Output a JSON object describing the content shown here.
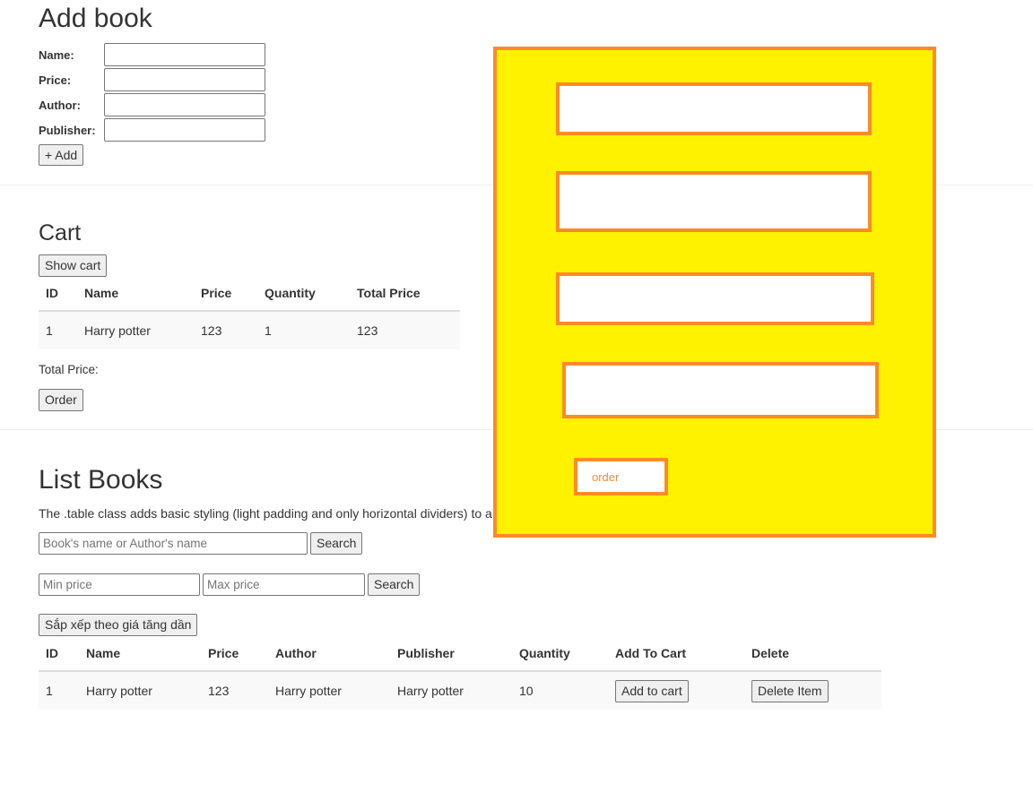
{
  "add_book": {
    "title": "Add book",
    "name_label": "Name:",
    "price_label": "Price:",
    "author_label": "Author:",
    "publisher_label": "Publisher:",
    "add_button": "+ Add"
  },
  "cart": {
    "title": "Cart",
    "show_button": "Show cart",
    "columns": [
      "ID",
      "Name",
      "Price",
      "Quantity",
      "Total Price"
    ],
    "rows": [
      [
        "1",
        "Harry potter",
        "123",
        "1",
        "123"
      ]
    ],
    "total_label": "Total Price:",
    "order_button": "Order"
  },
  "list_books": {
    "title": "List Books",
    "description": "The .table class adds basic styling (light padding and only horizontal dividers) to a",
    "search_placeholder": "Book's name or Author's name",
    "search_button": "Search",
    "min_placeholder": "Min price",
    "max_placeholder": "Max price",
    "price_search_button": "Search",
    "sort_button": "Sắp xếp theo giá tăng dần",
    "columns": [
      "ID",
      "Name",
      "Price",
      "Author",
      "Publisher",
      "Quantity",
      "Add To Cart",
      "Delete"
    ],
    "rows": [
      [
        "1",
        "Harry potter",
        "123",
        "Harry potter",
        "Harry potter",
        "10"
      ]
    ],
    "add_to_cart_button": "Add to cart",
    "delete_button": "Delete Item"
  },
  "order_panel": {
    "order_button": "order",
    "background_color": "#fff200",
    "border_color": "#ff8a26"
  }
}
